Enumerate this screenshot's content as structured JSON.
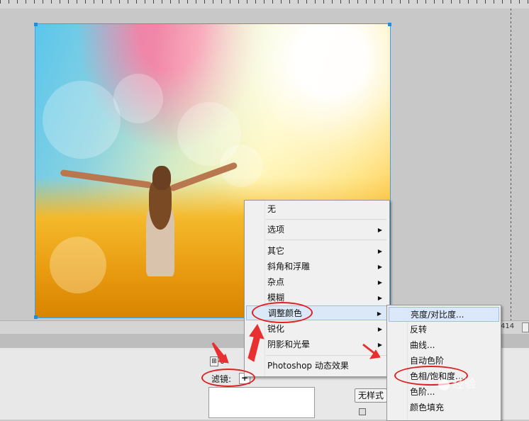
{
  "ruler": {
    "right_value": "414"
  },
  "panel": {
    "field_value": "0",
    "filter_label": "滤镜:",
    "filter_add": "+",
    "no_style_button": "无样式"
  },
  "context_menu": {
    "items": [
      {
        "label": "无",
        "submenu": false
      },
      {
        "label": "选项",
        "submenu": true
      },
      {
        "label": "其它",
        "submenu": true
      },
      {
        "label": "斜角和浮雕",
        "submenu": true
      },
      {
        "label": "杂点",
        "submenu": true
      },
      {
        "label": "模糊",
        "submenu": true
      },
      {
        "label": "调整颜色",
        "submenu": true,
        "highlighted": true
      },
      {
        "label": "锐化",
        "submenu": true
      },
      {
        "label": "阴影和光晕",
        "submenu": true
      },
      {
        "label": "Photoshop 动态效果",
        "submenu": false
      }
    ],
    "arrow_glyph": "▶"
  },
  "submenu": {
    "items": [
      {
        "label": "亮度/对比度...",
        "highlighted": true
      },
      {
        "label": "反转"
      },
      {
        "label": "曲线..."
      },
      {
        "label": "自动色阶"
      },
      {
        "label": "色相/饱和度..."
      },
      {
        "label": "色阶..."
      },
      {
        "label": "颜色填充"
      }
    ]
  },
  "watermark": {
    "text": "经验"
  },
  "colors": {
    "annotation_red": "#e02020",
    "selection_blue": "#1e8fe0",
    "menu_bg": "#f0f0f0",
    "highlight": "#dbe8f7"
  }
}
